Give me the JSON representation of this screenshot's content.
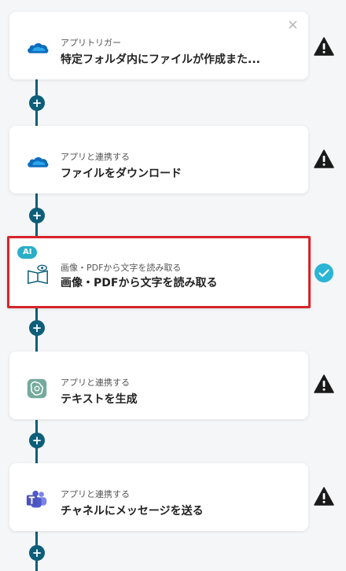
{
  "steps": [
    {
      "sub": "アプリトリガー",
      "main": "特定フォルダ内にファイルが作成また...",
      "icon": "onedrive-icon",
      "status": "warning-icon",
      "closable": true
    },
    {
      "sub": "アプリと連携する",
      "main": "ファイルをダウンロード",
      "icon": "onedrive-icon",
      "status": "warning-icon"
    },
    {
      "sub": "画像・PDFから文字を読み取る",
      "main": "画像・PDFから文字を読み取る",
      "icon": "ocr-book-icon",
      "status": "check-icon",
      "badge": "AI",
      "selected": true
    },
    {
      "sub": "アプリと連携する",
      "main": "テキストを生成",
      "icon": "chatgpt-icon",
      "status": "warning-icon"
    },
    {
      "sub": "アプリと連携する",
      "main": "チャネルにメッセージを送る",
      "icon": "teams-icon",
      "status": "warning-icon"
    }
  ],
  "add_button_label": "+",
  "close_label": "×",
  "colors": {
    "connector": "#0d5e78",
    "selected_border": "#d8242a",
    "check": "#2bb5d4",
    "ai_badge": "#2aaec8"
  }
}
